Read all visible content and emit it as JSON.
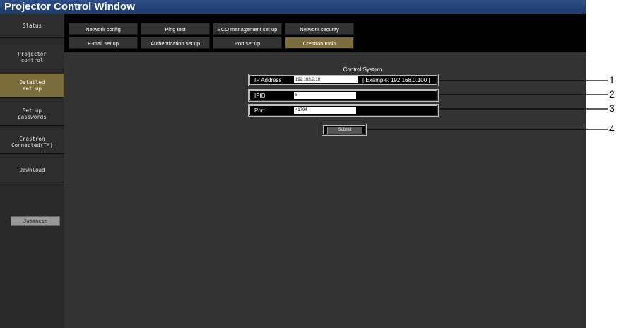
{
  "window": {
    "title": "Projector Control Window"
  },
  "sidebar": {
    "items": [
      {
        "label": "Status",
        "active": false
      },
      {
        "label": "Projector\ncontrol",
        "active": false
      },
      {
        "label": "Detailed\nset up",
        "active": true
      },
      {
        "label": "Set up\npasswords",
        "active": false
      },
      {
        "label": "Crestron\nConnected(TM)",
        "active": false
      },
      {
        "label": "Download",
        "active": false
      }
    ],
    "language_button": "Japanese"
  },
  "tabs": {
    "row1": [
      "Network config",
      "Ping test",
      "ECO management set up",
      "Network security"
    ],
    "row2": [
      "E-mail set up",
      "Authentication set up",
      "Port set up",
      "Crestron tools"
    ],
    "active": "Crestron tools"
  },
  "form": {
    "title": "Control System",
    "ip_label": "IP Address",
    "ip_value": "192.168.0.10",
    "ip_example": "[ Example: 192.168.0.100 ]",
    "ipid_label": "IPID",
    "ipid_value": "5",
    "port_label": "Port",
    "port_value": "41794",
    "submit_label": "Submit"
  },
  "callouts": [
    "1",
    "2",
    "3",
    "4"
  ],
  "colors": {
    "title_bar": "#1d3a6c",
    "active_item": "#7c6d3d",
    "content_bg": "#333333"
  }
}
